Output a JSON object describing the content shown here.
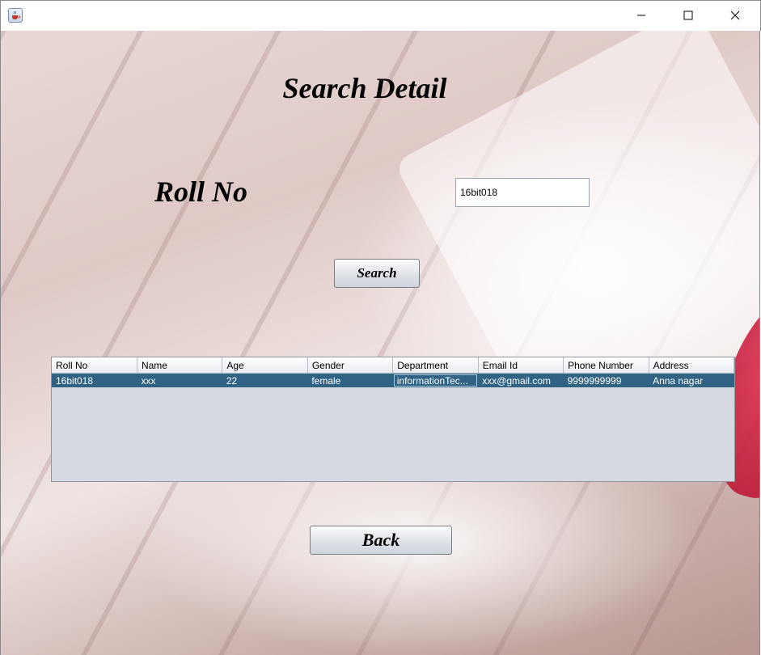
{
  "window": {
    "icon": "java-coffee-icon",
    "controls": [
      "minimize-icon",
      "maximize-icon",
      "close-icon"
    ]
  },
  "page": {
    "title": "Search Detail",
    "roll_label": "Roll No",
    "roll_value": "16bit018",
    "search_label": "Search",
    "back_label": "Back"
  },
  "table": {
    "headers": [
      "Roll No",
      "Name",
      "Age",
      "Gender",
      "Department",
      "Email Id",
      "Phone Number",
      "Address"
    ],
    "rows": [
      [
        "16bit018",
        "xxx",
        "22",
        "female",
        "informationTec...",
        "xxx@gmail.com",
        "9999999999",
        "Anna nagar"
      ]
    ]
  },
  "colors": {
    "selection": "#2f6283",
    "table_bg": "#d6d9e0",
    "accent_petal": "#c41a38"
  }
}
